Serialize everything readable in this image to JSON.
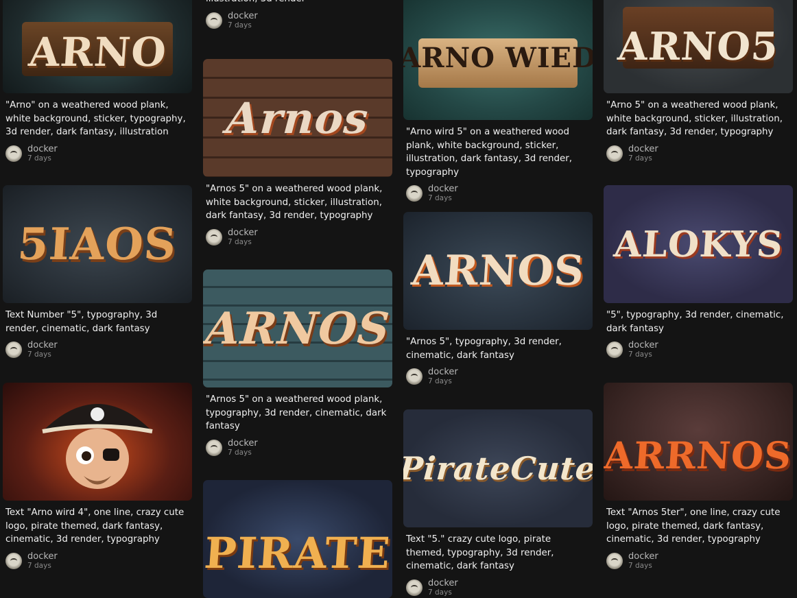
{
  "cards": [
    {
      "id": "c1",
      "art": "ARNO",
      "caption": "\"Arno\" on a weathered wood plank, white background, sticker, typography, 3d render, dark fantasy, illustration",
      "user": "docker",
      "time": "7 days"
    },
    {
      "id": "c2",
      "art": "",
      "caption": "illustration, 3d render",
      "user": "docker",
      "time": "7 days"
    },
    {
      "id": "c3",
      "art": "ARNO WIED",
      "caption": "\"Arno wird 5\" on a weathered wood plank, white background, sticker, illustration, dark fantasy, 3d render, typography",
      "user": "docker",
      "time": "7 days"
    },
    {
      "id": "c4",
      "art": "ARNO5",
      "caption": "\"Arno 5\" on a weathered wood plank, white background, sticker, illustration, dark fantasy, 3d render, typography",
      "user": "docker",
      "time": "7 days"
    },
    {
      "id": "c5",
      "art": "Arnos",
      "caption": "\"Arnos 5\" on a weathered wood plank, white background, sticker, illustration, dark fantasy, 3d render, typography",
      "user": "docker",
      "time": "7 days"
    },
    {
      "id": "c6",
      "art": "5IAOS",
      "caption": "Text Number \"5\", typography, 3d render, cinematic, dark fantasy",
      "user": "docker",
      "time": "7 days"
    },
    {
      "id": "c7",
      "art": "ARNOS",
      "caption": "\"Arnos 5\", typography, 3d render, cinematic, dark fantasy",
      "user": "docker",
      "time": "7 days"
    },
    {
      "id": "c8",
      "art": "ALOKYS",
      "caption": "\"5\", typography, 3d render, cinematic, dark fantasy",
      "user": "docker",
      "time": "7 days"
    },
    {
      "id": "c9",
      "art": "ARNOS",
      "caption": "\"Arnos 5\" on a weathered wood plank, typography, 3d render, cinematic, dark fantasy",
      "user": "docker",
      "time": "7 days"
    },
    {
      "id": "c10",
      "art": "",
      "caption": "Text \"Arno wird 4\", one line, crazy cute logo, pirate themed, dark fantasy, cinematic, 3d render, typography",
      "user": "docker",
      "time": "7 days"
    },
    {
      "id": "c11",
      "art": "PirateCute",
      "caption": "Text \"5.\" crazy cute logo, pirate themed, typography, 3d render, cinematic, dark fantasy",
      "user": "docker",
      "time": "7 days"
    },
    {
      "id": "c12",
      "art": "ARRNOS",
      "caption": "Text \"Arnos 5ter\", one line, crazy cute logo, pirate themed, dark fantasy, cinematic, 3d render, typography",
      "user": "docker",
      "time": "7 days"
    },
    {
      "id": "c13",
      "art": "PIRATE",
      "caption": "",
      "user": "",
      "time": ""
    }
  ]
}
